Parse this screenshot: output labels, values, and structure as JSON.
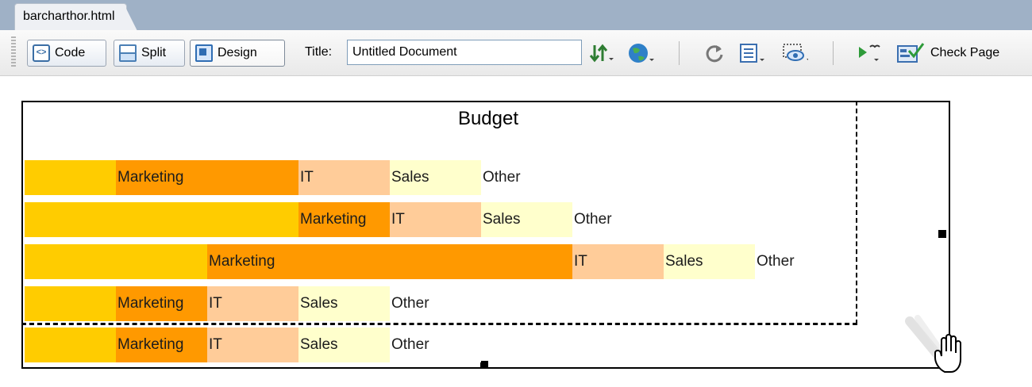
{
  "tab": {
    "filename": "barcharthor.html"
  },
  "toolbar": {
    "views": [
      {
        "label": "Code",
        "icon": "code-view-icon"
      },
      {
        "label": "Split",
        "icon": "split-view-icon"
      },
      {
        "label": "Design",
        "icon": "design-view-icon",
        "active": true
      }
    ],
    "title_label": "Title:",
    "title_value": "Untitled Document",
    "check_page_label": "Check Page"
  },
  "chart_data": {
    "type": "bar",
    "title": "Budget",
    "orientation": "horizontal-stacked",
    "categories": [
      "Marketing",
      "IT",
      "Sales",
      "Other"
    ],
    "colors": {
      "base": "#ffcc00",
      "Marketing": "#ff9900",
      "IT": "#ffcc99",
      "Sales": "#ffffcc",
      "Other": "#ffffff"
    },
    "rows": [
      {
        "base": 1,
        "Marketing": 2,
        "IT": 1,
        "Sales": 1,
        "Other": 1
      },
      {
        "base": 3,
        "Marketing": 1,
        "IT": 1,
        "Sales": 1,
        "Other": 1
      },
      {
        "base": 2,
        "Marketing": 4,
        "IT": 1,
        "Sales": 1,
        "Other": 1
      },
      {
        "base": 1,
        "Marketing": 1,
        "IT": 1,
        "Sales": 1,
        "Other": 1
      },
      {
        "base": 1,
        "Marketing": 1,
        "IT": 1,
        "Sales": 1,
        "Other": 1
      }
    ]
  }
}
